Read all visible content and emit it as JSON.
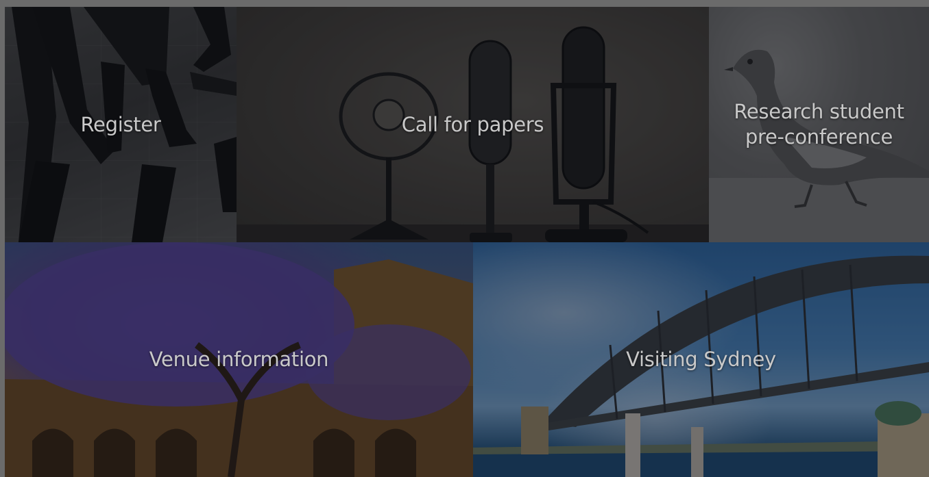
{
  "tiles": [
    {
      "key": "register",
      "label": "Register"
    },
    {
      "key": "call_for_papers",
      "label": "Call for papers"
    },
    {
      "key": "research_student",
      "label": "Research student\npre-conference"
    },
    {
      "key": "venue_information",
      "label": "Venue information"
    },
    {
      "key": "visiting_sydney",
      "label": "Visiting Sydney"
    }
  ],
  "colors": {
    "backdrop": "#6b6b6b",
    "label_text": "#c9c9c9",
    "overlay": "rgba(10,12,18,0.42)"
  }
}
